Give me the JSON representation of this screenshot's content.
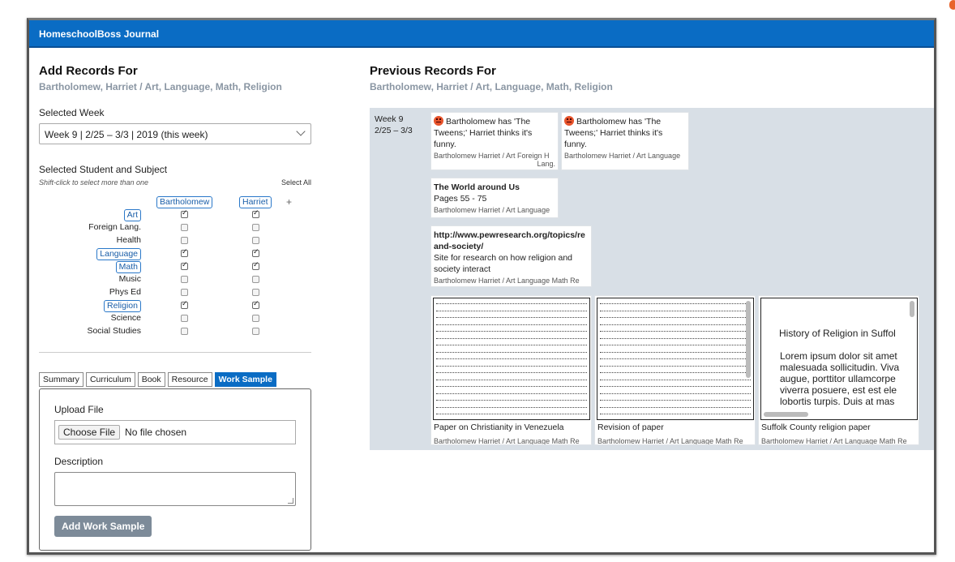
{
  "app": {
    "title": "HomeschoolBoss Journal"
  },
  "add": {
    "heading": "Add Records For",
    "crumb": "Bartholomew, Harriet  /  Art, Language, Math, Religion",
    "week_label": "Selected Week",
    "week_value": "Week 9 | 2/25 – 3/3 | 2019 (this week)",
    "student_label": "Selected Student and Subject",
    "hint": "Shift-click to select more than one",
    "select_all": "Select All",
    "students": [
      "Bartholomew",
      "Harriet"
    ],
    "plus": "+",
    "subjects": [
      {
        "name": "Art",
        "selected": true,
        "b": true,
        "h": true
      },
      {
        "name": "Foreign Lang.",
        "selected": false,
        "b": false,
        "h": false
      },
      {
        "name": "Health",
        "selected": false,
        "b": false,
        "h": false
      },
      {
        "name": "Language",
        "selected": true,
        "b": true,
        "h": true
      },
      {
        "name": "Math",
        "selected": true,
        "b": true,
        "h": true
      },
      {
        "name": "Music",
        "selected": false,
        "b": false,
        "h": false
      },
      {
        "name": "Phys Ed",
        "selected": false,
        "b": false,
        "h": false
      },
      {
        "name": "Religion",
        "selected": true,
        "b": true,
        "h": true
      },
      {
        "name": "Science",
        "selected": false,
        "b": false,
        "h": false
      },
      {
        "name": "Social Studies",
        "selected": false,
        "b": false,
        "h": false
      }
    ],
    "tabs": [
      "Summary",
      "Curriculum",
      "Book",
      "Resource",
      "Work Sample"
    ],
    "active_tab": "Work Sample",
    "upload_label": "Upload File",
    "choose_file": "Choose File",
    "no_file": "No file chosen",
    "description_label": "Description",
    "submit": "Add Work Sample"
  },
  "previous": {
    "heading": "Previous Records For",
    "crumb": "Bartholomew, Harriet  /  Art, Language, Math, Religion",
    "week": "Week 9",
    "range": "2/25 – 3/3",
    "cards": {
      "c1_text": "Bartholomew has 'The Tweens;' Harriet thinks it's funny.",
      "c1_meta": "Bartholomew Harriet / Art Foreign H",
      "c1_meta2": "Lang.",
      "c2_text": "Bartholomew has 'The Tweens;' Harriet thinks it's funny.",
      "c2_meta": "Bartholomew Harriet / Art Language",
      "c3_title": "The World around Us",
      "c3_text": "Pages 55 - 75",
      "c3_meta": "Bartholomew Harriet / Art Language",
      "c4_title": "http://www.pewresearch.org/topics/re and-society/",
      "c4_text": "Site for research on how religion and society interact",
      "c4_meta": "Bartholomew Harriet / Art Language Math Re",
      "s1_caption": "Paper on Christianity in Venezuela",
      "s1_meta": "Bartholomew Harriet / Art Language Math Re",
      "s2_caption": "Revision of paper",
      "s2_meta": "Bartholomew Harriet / Art Language Math Re",
      "s3_caption": "Suffolk County religion paper",
      "s3_meta": "Bartholomew Harriet / Art Language Math Re",
      "s3_doc_title": "History of Religion in Suffol",
      "s3_doc_body": [
        "Lorem ipsum dolor sit amet",
        "malesuada sollicitudin. Viva",
        "augue, porttitor ullamcorpe",
        "viverra posuere, est est ele",
        "lobortis turpis. Duis at mas"
      ]
    }
  }
}
